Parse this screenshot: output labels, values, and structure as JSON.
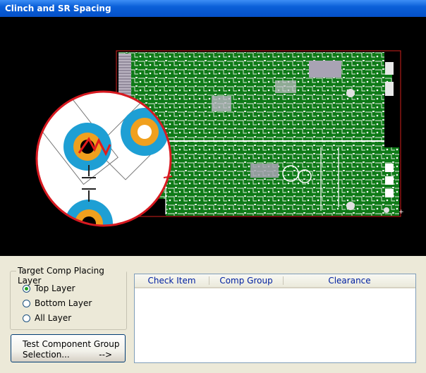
{
  "window": {
    "title": "Clinch and SR Spacing"
  },
  "group": {
    "legend": "Target Comp Placing Layer",
    "options": [
      {
        "label": "Top Layer",
        "checked": true
      },
      {
        "label": "Bottom Layer",
        "checked": false
      },
      {
        "label": "All Layer",
        "checked": false
      }
    ]
  },
  "button": {
    "line1": "Test Component Group",
    "line2": "Selection...",
    "arrow": "-->"
  },
  "table": {
    "columns": [
      "Check Item",
      "Comp Group",
      "Clearance"
    ],
    "rows": []
  },
  "colors": {
    "titlebar": "#0a5fd8",
    "canvas_bg": "#000000",
    "board": "#0e7a17",
    "magnifier_ring": "#d71920",
    "pad_outer": "#1e9fd4",
    "pad_inner": "#f0a01e"
  },
  "icons": {
    "callout": "magnifier-callout",
    "violation": "zigzag-violation-marker"
  }
}
